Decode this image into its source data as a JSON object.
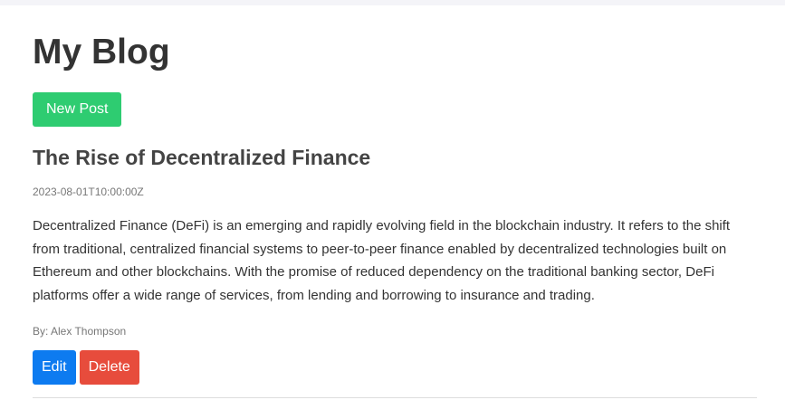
{
  "header": {
    "title": "My Blog",
    "new_post_label": "New Post"
  },
  "posts": [
    {
      "title": "The Rise of Decentralized Finance",
      "date": "2023-08-01T10:00:00Z",
      "body": "Decentralized Finance (DeFi) is an emerging and rapidly evolving field in the blockchain industry. It refers to the shift from traditional, centralized financial systems to peer-to-peer finance enabled by decentralized technologies built on Ethereum and other blockchains. With the promise of reduced dependency on the traditional banking sector, DeFi platforms offer a wide range of services, from lending and borrowing to insurance and trading.",
      "author": "By: Alex Thompson",
      "edit_label": "Edit",
      "delete_label": "Delete"
    }
  ],
  "colors": {
    "new_post_button": "#2ecc71",
    "edit_button": "#0d7bf0",
    "delete_button": "#e74c3c"
  }
}
